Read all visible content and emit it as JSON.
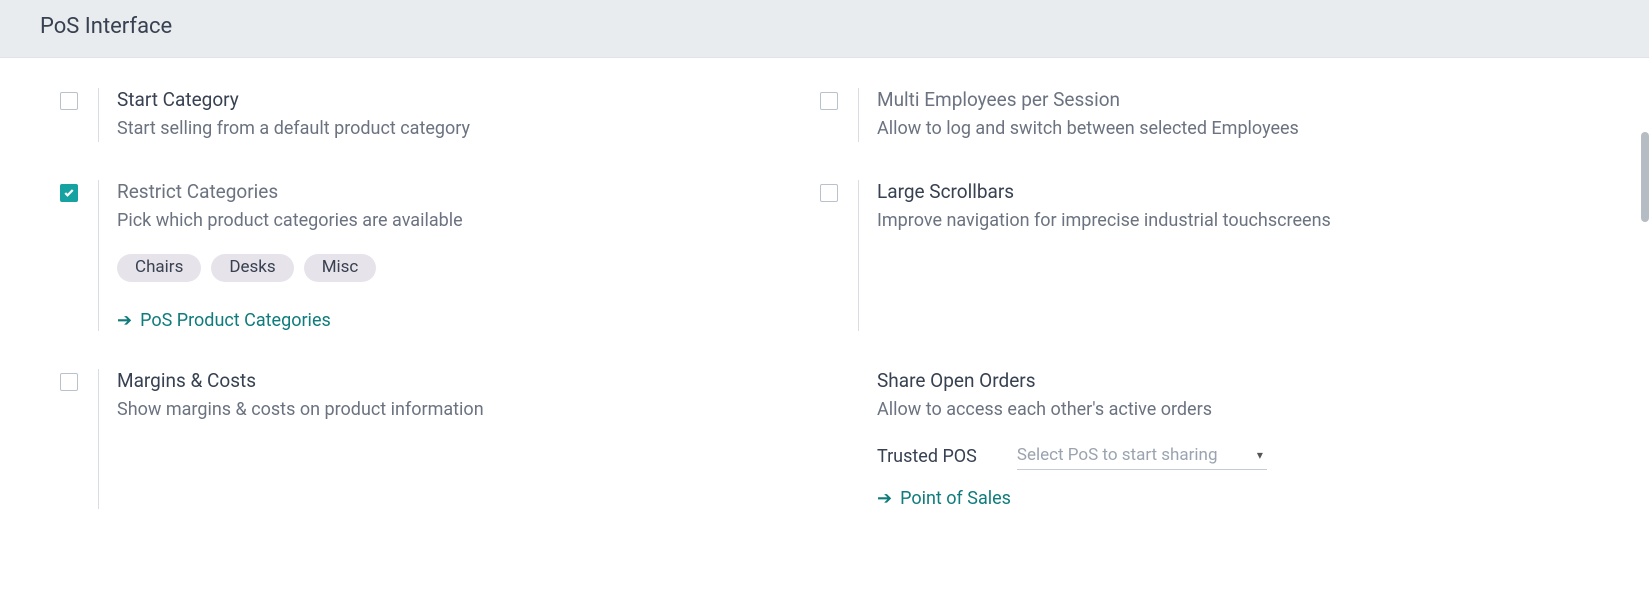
{
  "section_title": "PoS Interface",
  "settings": {
    "start_category": {
      "title": "Start Category",
      "desc": "Start selling from a default product category"
    },
    "multi_employees": {
      "title": "Multi Employees per Session",
      "desc": "Allow to log and switch between selected Employees"
    },
    "restrict_categories": {
      "title": "Restrict Categories",
      "desc": "Pick which product categories are available",
      "tags": [
        "Chairs",
        "Desks",
        "Misc"
      ],
      "link_label": "PoS Product Categories"
    },
    "large_scrollbars": {
      "title": "Large Scrollbars",
      "desc": "Improve navigation for imprecise industrial touchscreens"
    },
    "margins_costs": {
      "title": "Margins & Costs",
      "desc": "Show margins & costs on product information"
    },
    "share_open_orders": {
      "title": "Share Open Orders",
      "desc": "Allow to access each other's active orders",
      "field_label": "Trusted POS",
      "select_placeholder": "Select PoS to start sharing",
      "link_label": "Point of Sales"
    }
  }
}
